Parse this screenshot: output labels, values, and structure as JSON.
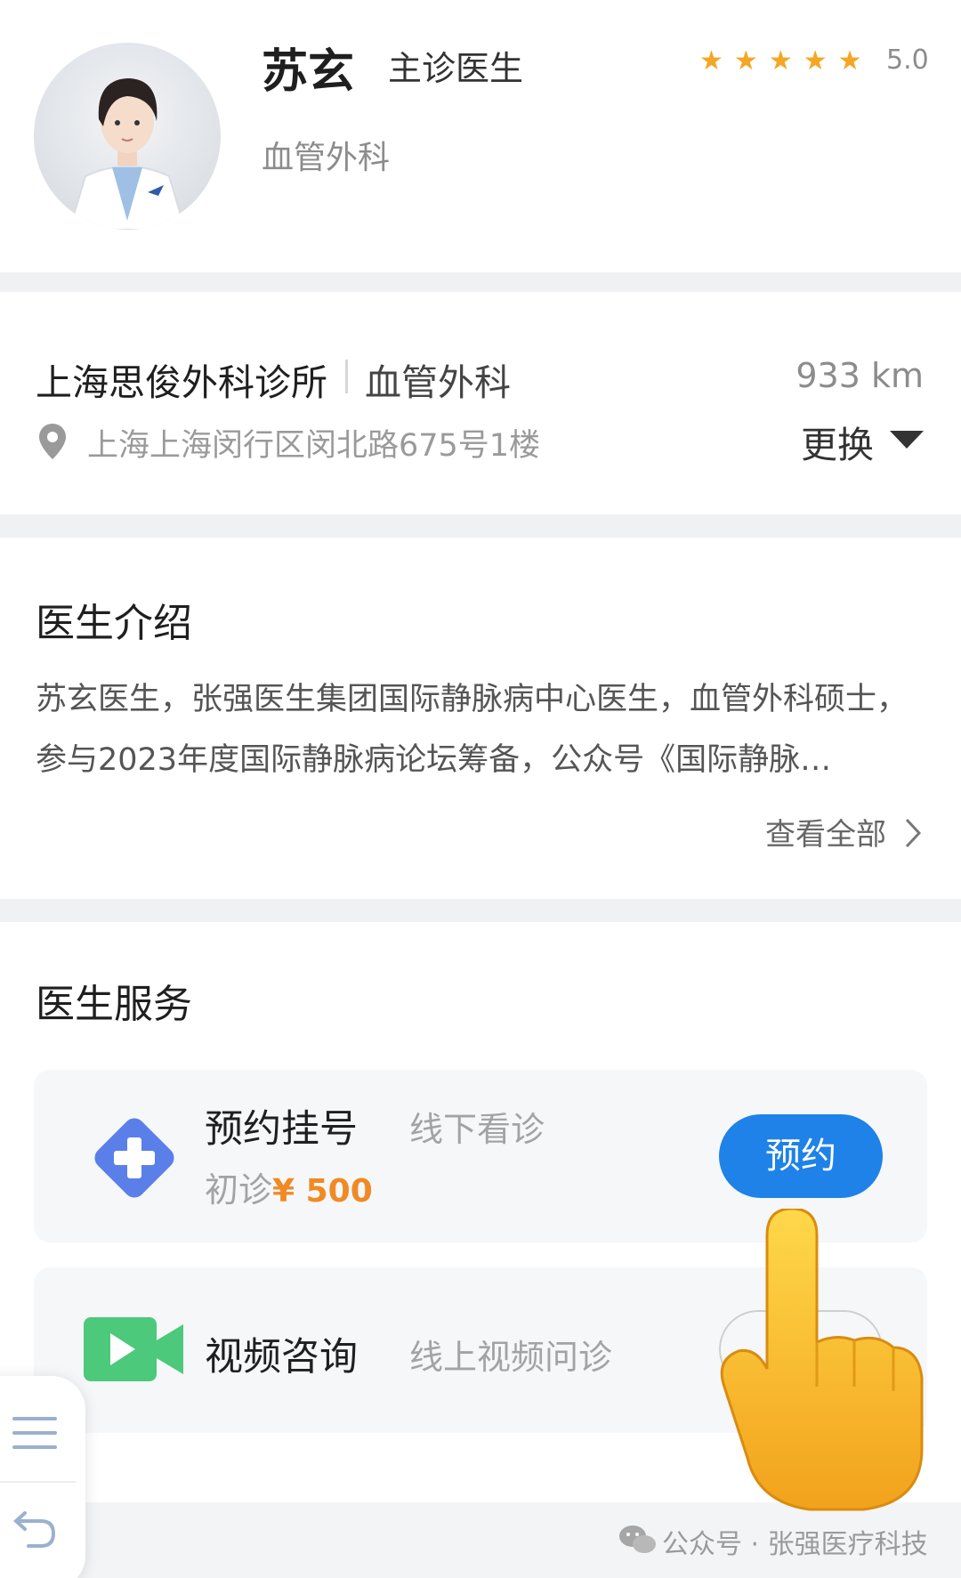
{
  "doctor": {
    "name": "苏玄",
    "title": "主诊医生",
    "department": "血管外科",
    "rating": "5.0",
    "star_count": 5
  },
  "clinic": {
    "name": "上海思俊外科诊所",
    "department": "血管外科",
    "distance": "933 km",
    "address": "上海上海闵行区闵北路675号1楼",
    "change_label": "更换"
  },
  "intro": {
    "heading": "医生介绍",
    "text": "苏玄医生，张强医生集团国际静脉病中心医生，血管外科硕士，参与2023年度国际静脉病论坛筹备，公众号《国际静脉…",
    "view_all": "查看全部"
  },
  "services": {
    "heading": "医生服务",
    "items": [
      {
        "name": "预约挂号",
        "desc": "线下看诊",
        "sub_label": "初诊",
        "price": "¥ 500",
        "action": "预约",
        "icon": "medical-cross-icon",
        "icon_color": "#5b7fe8"
      },
      {
        "name": "视频咨询",
        "desc": "线上视频问诊",
        "icon": "video-camera-icon",
        "icon_color": "#4cc97a"
      }
    ]
  },
  "watermark": "公众号 · 张强医疗科技",
  "colors": {
    "accent": "#1e82e8",
    "star": "#f5a623",
    "price": "#f08a24"
  }
}
